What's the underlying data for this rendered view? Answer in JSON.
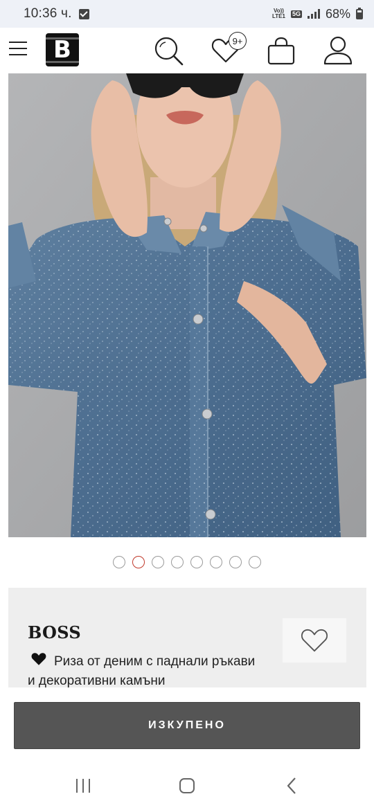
{
  "status_bar": {
    "time": "10:36 ч.",
    "volte_top": "Vo))",
    "volte_bottom": "LTE1",
    "network": "5G",
    "battery": "68%"
  },
  "header": {
    "logo_letter": "B",
    "wishlist_badge": "9+",
    "icons": [
      "menu-icon",
      "search-icon",
      "heart-icon",
      "bag-icon",
      "user-icon"
    ]
  },
  "carousel": {
    "total": 8,
    "active_index": 1,
    "active_color": "#c0392b"
  },
  "product": {
    "brand": "BOSS",
    "description_line1": "Риза от деним с паднали ръкави",
    "description_line2": "и декоративни камъни"
  },
  "buy_button": {
    "label": "ИЗКУПЕНО"
  },
  "colors": {
    "button_bg": "#555555",
    "card_bg": "#eeeeee",
    "status_bg": "#eef1f7"
  }
}
